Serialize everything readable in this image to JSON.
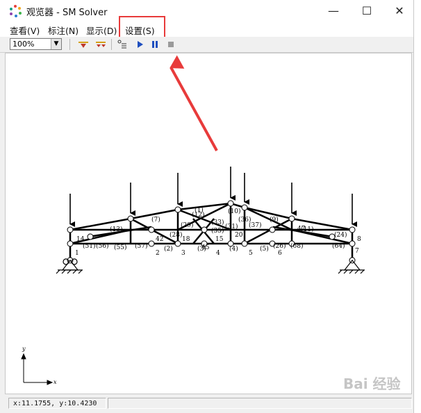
{
  "window": {
    "title": "观览器 - SM Solver",
    "minimize": "—",
    "maximize": "☐",
    "close": "✕"
  },
  "menu": {
    "items": [
      "查看(V)",
      "标注(N)",
      "显示(D)",
      "设置(S)"
    ]
  },
  "toolbar": {
    "zoom_value": "100%"
  },
  "diagram": {
    "node_labels": [
      "1",
      "2",
      "3",
      "4",
      "5",
      "6",
      "7",
      "8",
      "14",
      "15",
      "18",
      "20",
      "42",
      "45",
      "47"
    ],
    "member_labels": [
      "(12)",
      "(9)",
      "(7)",
      "(10)",
      "(29)",
      "(28)",
      "(37)",
      "(36)",
      "(33)",
      "(35)",
      "(31)",
      "(51)",
      "(56)",
      "(57)",
      "(55)",
      "(68)",
      "(64)",
      "(24)",
      "(26)",
      "(2)",
      "(3)",
      "(4)",
      "(5)",
      "(1)",
      "(13)",
      "(11)"
    ],
    "axis": {
      "x_label": "x",
      "y_label": "y"
    }
  },
  "status": {
    "coordinates": "x:11.1755, y:10.4230"
  },
  "annotation": {
    "highlight_color": "#e83b3b"
  },
  "watermark": "Bai 经验"
}
